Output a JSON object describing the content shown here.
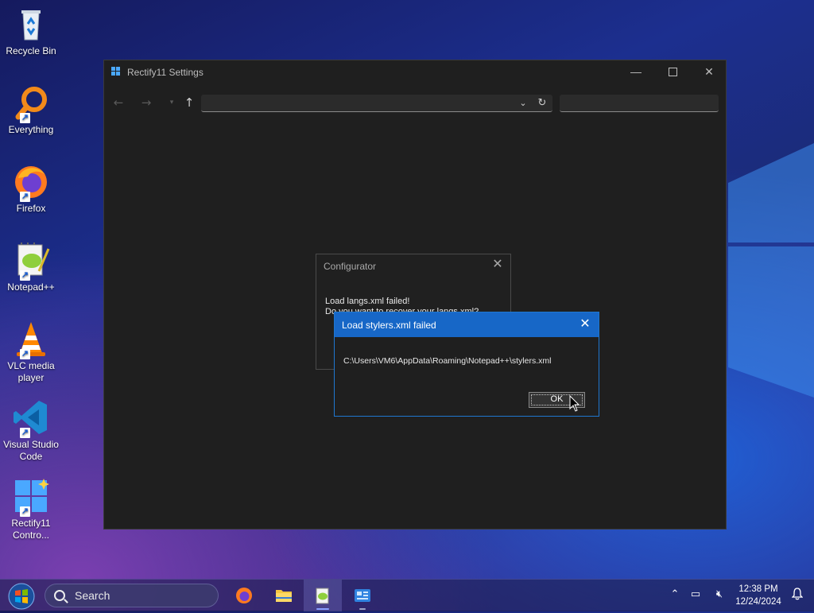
{
  "desktop": {
    "icons": [
      {
        "label": "Recycle Bin",
        "icon": "recycle-bin-icon"
      },
      {
        "label": "Everything",
        "icon": "everything-search-icon"
      },
      {
        "label": "Firefox",
        "icon": "firefox-icon"
      },
      {
        "label": "Notepad++",
        "icon": "notepadpp-icon"
      },
      {
        "label": "VLC media player",
        "icon": "vlc-icon"
      },
      {
        "label": "Visual Studio Code",
        "icon": "vscode-icon"
      },
      {
        "label": "Rectify11 Contro...",
        "icon": "rectify11-control-icon"
      }
    ]
  },
  "window": {
    "title": "Rectify11 Settings",
    "address": "",
    "search": ""
  },
  "configurator": {
    "title": "Configurator",
    "message_line1": "Load langs.xml failed!",
    "message_line2": "Do you want to recover your langs.xml?"
  },
  "error_dialog": {
    "title": "Load stylers.xml failed",
    "path": "C:\\Users\\VM6\\AppData\\Roaming\\Notepad++\\stylers.xml",
    "ok_label": "OK"
  },
  "taskbar": {
    "search_label": "Search",
    "time": "12:38 PM",
    "date": "12/24/2024"
  },
  "colors": {
    "dialog_title_bar": "#1767c7",
    "window_bg": "#1f1f1f",
    "accent": "#1f77d0"
  }
}
